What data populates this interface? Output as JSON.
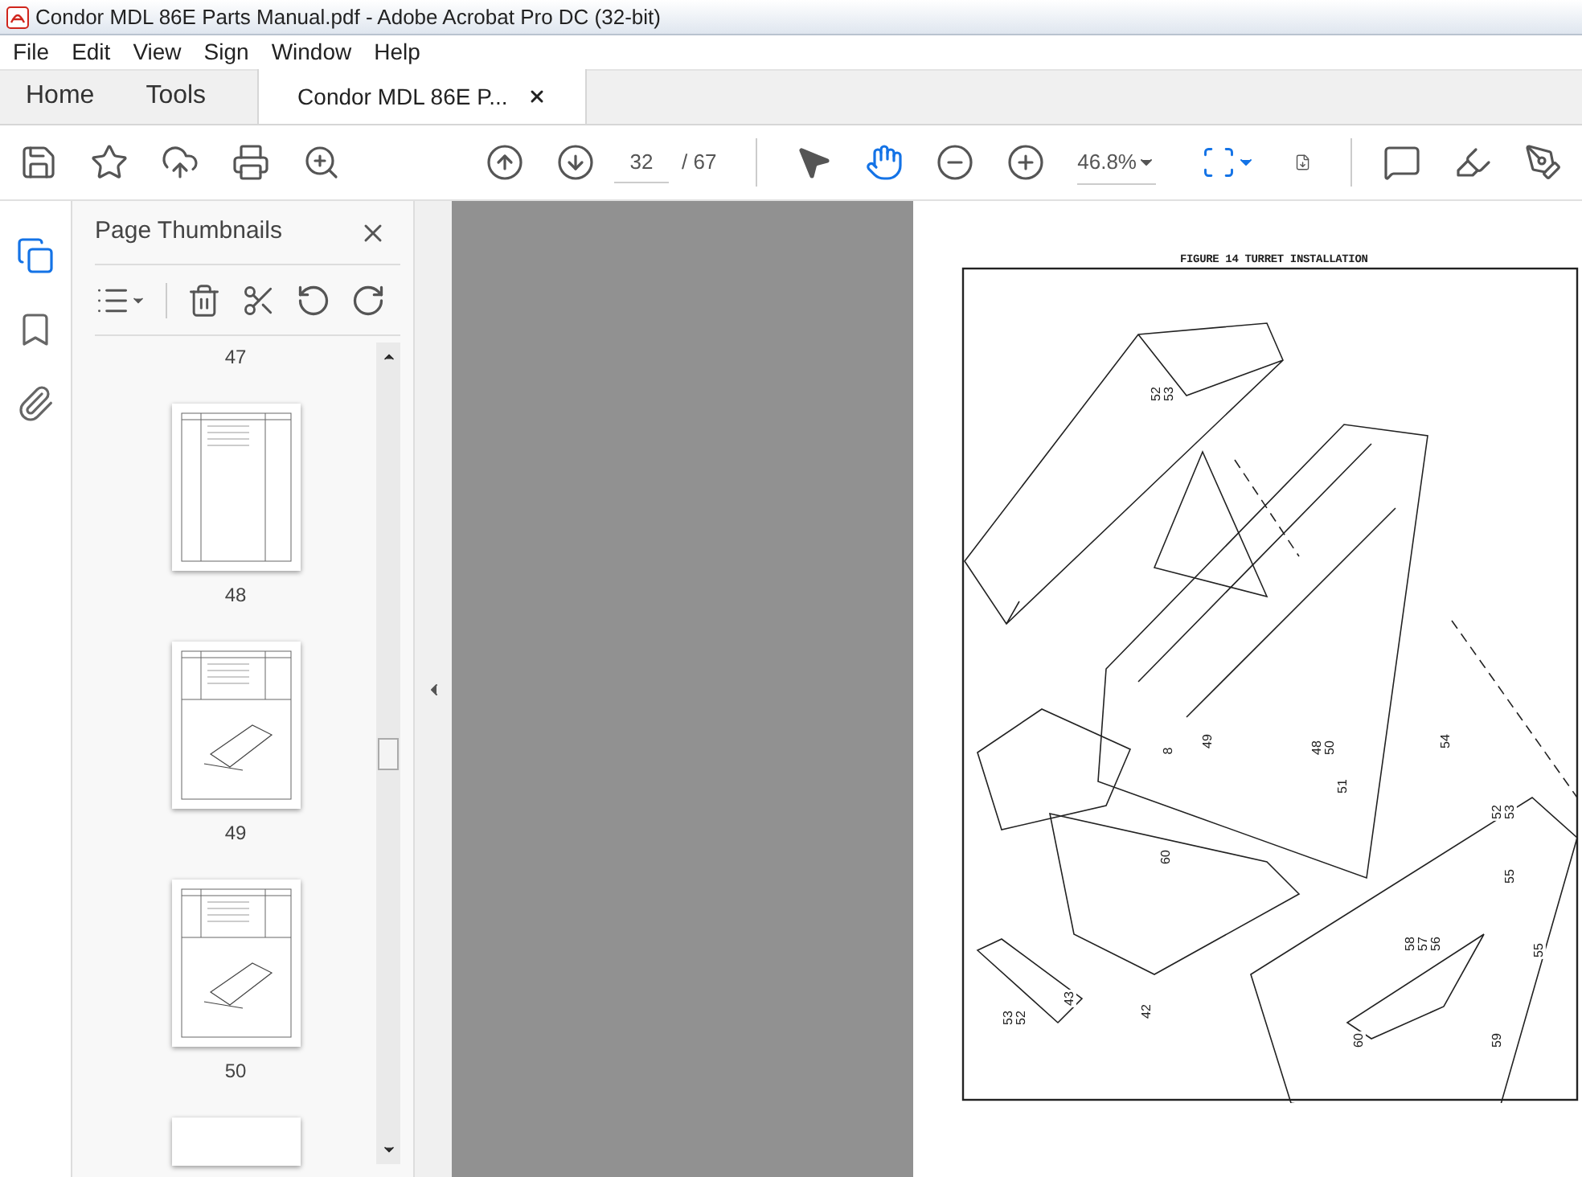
{
  "window": {
    "title": "Condor MDL 86E Parts Manual.pdf - Adobe Acrobat Pro DC (32-bit)"
  },
  "menu": [
    "File",
    "Edit",
    "View",
    "Sign",
    "Window",
    "Help"
  ],
  "tabs": [
    {
      "label": "Home",
      "selected": false,
      "closable": false
    },
    {
      "label": "Tools",
      "selected": false,
      "closable": false
    },
    {
      "label": "Condor MDL 86E P...",
      "selected": true,
      "closable": true
    }
  ],
  "toolbar": {
    "page": "32",
    "page_total": "/ 67",
    "zoom": "46.8%",
    "tools": [
      {
        "selected": false
      },
      {
        "selected": true
      }
    ]
  },
  "rail": [
    {
      "kind": "pages",
      "selected": true
    },
    {
      "kind": "bookmarks",
      "selected": false
    },
    {
      "kind": "attachments",
      "selected": false
    }
  ],
  "thumbnails_panel": {
    "title": "Page Thumbnails",
    "items": [
      {
        "label": "47",
        "kind": "label_only"
      },
      {
        "label": "48",
        "kind": "table"
      },
      {
        "label": "49",
        "kind": "figure"
      },
      {
        "label": "50",
        "kind": "figure"
      },
      {
        "kind": "partial"
      }
    ]
  },
  "document": {
    "figure_title": "FIGURE 14 TURRET INSTALLATION",
    "callouts": [
      [
        "52",
        "53"
      ],
      [
        "8"
      ],
      [
        "49"
      ],
      [
        "48",
        "50"
      ],
      [
        "51"
      ],
      [
        "54"
      ],
      [
        "52",
        "53"
      ],
      [
        "55"
      ],
      [
        "58",
        "57",
        "56"
      ],
      [
        "55"
      ],
      [
        "60"
      ],
      [
        "59"
      ],
      [
        "60"
      ],
      [
        "42"
      ],
      [
        "43"
      ],
      [
        "53",
        "52"
      ]
    ]
  }
}
